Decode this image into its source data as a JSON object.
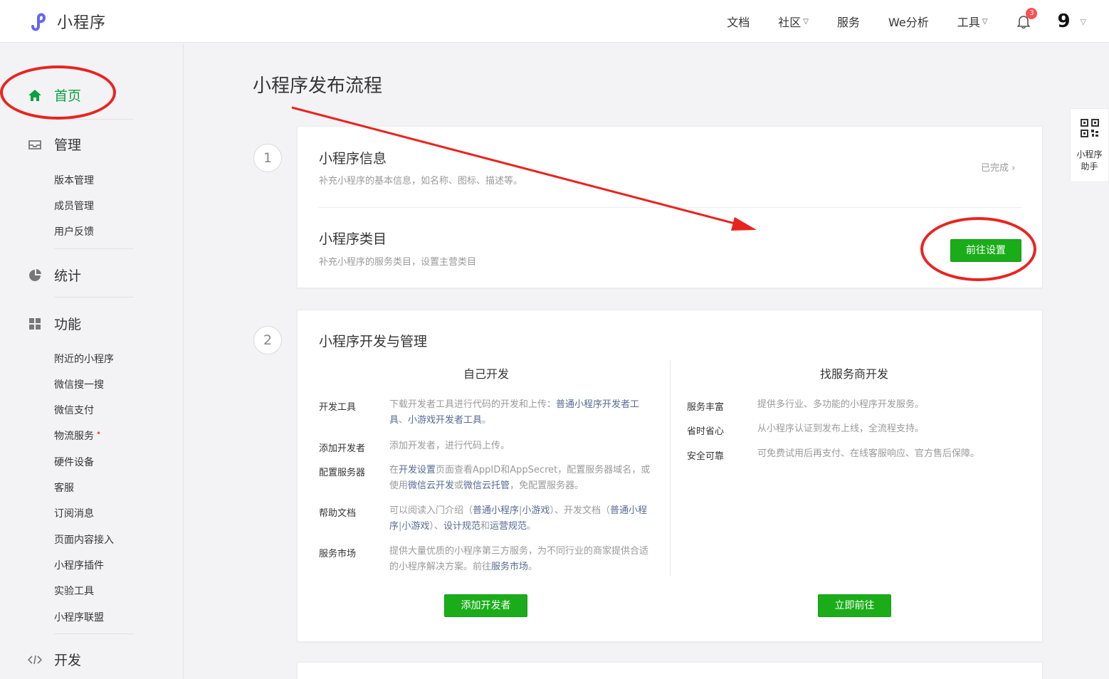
{
  "header": {
    "logo_text": "小程序",
    "nav": [
      {
        "label": "文档",
        "dropdown": false
      },
      {
        "label": "社区",
        "dropdown": true
      },
      {
        "label": "服务",
        "dropdown": false
      },
      {
        "label": "We分析",
        "dropdown": false
      },
      {
        "label": "工具",
        "dropdown": true
      }
    ],
    "notification_count": "3",
    "avatar_text": "9"
  },
  "sidebar": {
    "home": "首页",
    "manage": "管理",
    "manage_items": [
      "版本管理",
      "成员管理",
      "用户反馈"
    ],
    "stats": "统计",
    "features": "功能",
    "feature_items": [
      "附近的小程序",
      "微信搜一搜",
      "微信支付",
      "物流服务",
      "硬件设备",
      "客服",
      "订阅消息",
      "页面内容接入",
      "小程序插件",
      "实验工具",
      "小程序联盟"
    ],
    "new_dot": "•",
    "dev": "开发"
  },
  "main": {
    "title": "小程序发布流程",
    "step1": {
      "number": "1",
      "info_title": "小程序信息",
      "info_desc": "补充小程序的基本信息，如名称、图标、描述等。",
      "info_status": "已完成 ›",
      "category_title": "小程序类目",
      "category_desc": "补充小程序的服务类目，设置主营类目",
      "category_button": "前往设置"
    },
    "step2": {
      "number": "2",
      "title": "小程序开发与管理",
      "self_dev": {
        "title": "自己开发",
        "rows": [
          {
            "label": "开发工具",
            "pre": "下载开发者工具进行代码的开发和上传：",
            "link1": "普通小程序开发者工具",
            "mid": "、",
            "link2": "小游戏开发者工具",
            "post": "。"
          },
          {
            "label": "添加开发者",
            "text": "添加开发者，进行代码上传。"
          },
          {
            "label": "配置服务器",
            "pre": "在",
            "link1": "开发设置",
            "mid1": "页面查看AppID和AppSecret，配置服务器域名，或使用",
            "link2": "微信云开发",
            "mid2": "或",
            "link3": "微信云托管",
            "post": "，免配置服务器。"
          },
          {
            "label": "帮助文档",
            "pre": "可以阅读入门介绍（",
            "link1": "普通小程序",
            "sep1": "|",
            "link2": "小游戏",
            "mid1": "）、开发文档（",
            "link3": "普通小程序",
            "sep2": "|",
            "link4": "小游戏",
            "mid2": "）、",
            "link5": "设计规范",
            "and": "和",
            "link6": "运营规范",
            "post": "。"
          },
          {
            "label": "服务市场",
            "pre": "提供大量优质的小程序第三方服务，为不同行业的商家提供合适的小程序解决方案。前往",
            "link1": "服务市场",
            "post": "。"
          }
        ],
        "button": "添加开发者"
      },
      "vendor_dev": {
        "title": "找服务商开发",
        "rows": [
          {
            "label": "服务丰富",
            "text": "提供多行业、多功能的小程序开发服务。"
          },
          {
            "label": "省时省心",
            "text": "从小程序认证到发布上线，全流程支持。"
          },
          {
            "label": "安全可靠",
            "text": "可免费试用后再支付、在线客服响应、官方售后保障。"
          }
        ],
        "button": "立即前往"
      }
    }
  },
  "float_helper": {
    "label_line1": "小程序",
    "label_line2": "助手"
  },
  "colors": {
    "accent_green": "#1aad19",
    "active_green": "#07a33c",
    "annotation_red": "#e8241f",
    "link_blue": "#576b95"
  }
}
